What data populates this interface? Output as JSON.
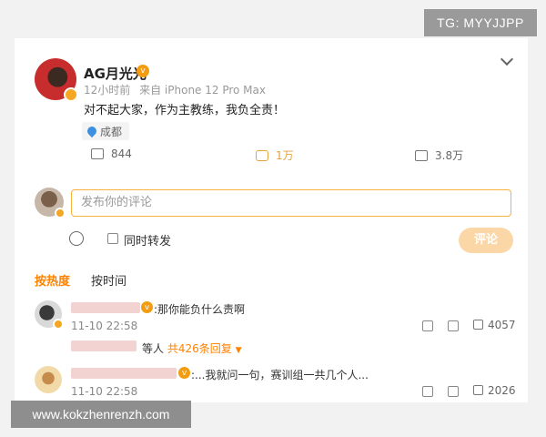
{
  "watermarks": {
    "top": "TG: MYYJJPP",
    "bottom": "www.kokzhenrenzh.com"
  },
  "post": {
    "author": "AG月光光",
    "time": "12小时前",
    "source": "来自 iPhone 12 Pro Max",
    "text": "对不起大家，作为主教练，我负全责！",
    "location": "成都",
    "reposts": "844",
    "comments": "1万",
    "likes": "3.8万"
  },
  "composer": {
    "placeholder": "发布你的评论",
    "repost_label": "同时转发",
    "submit_label": "评论"
  },
  "sort_tabs": {
    "hot": "按热度",
    "time": "按时间"
  },
  "comments": [
    {
      "text": ":那你能负什么责啊",
      "time": "11-10 22:58",
      "likes": "4057",
      "replies_prefix": "等人",
      "replies_count": "共426条回复"
    },
    {
      "text": ":...我就问一句，赛训组一共几个人...",
      "time": "11-10 22:58",
      "likes": "2026"
    }
  ],
  "colors": {
    "accent": "#ff8200",
    "input_border": "#f7b23b",
    "submit_bg": "#fbd7a8"
  }
}
